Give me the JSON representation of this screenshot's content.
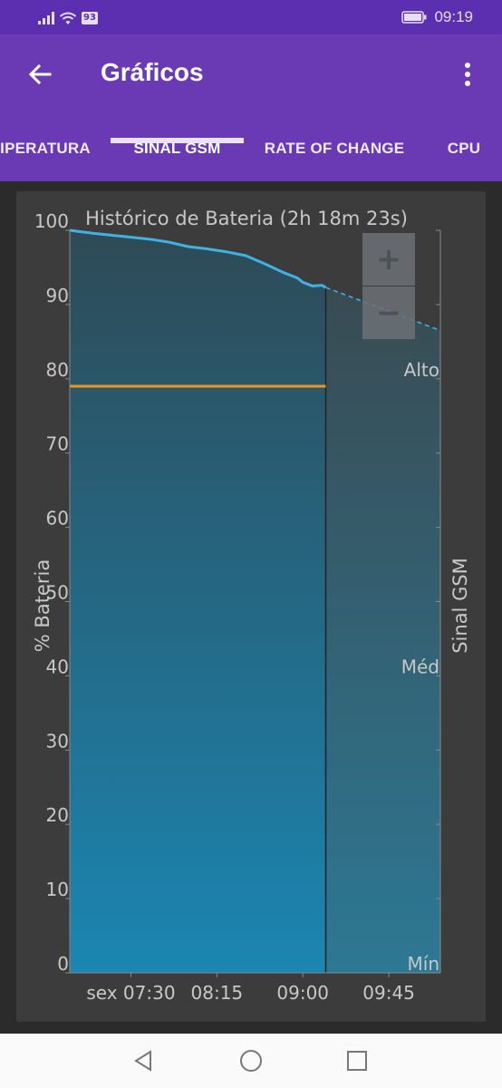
{
  "status_bar": {
    "battery_badge": "93",
    "time": "09:19"
  },
  "app_bar": {
    "title": "Gráficos"
  },
  "tabs": [
    {
      "label": "IPERATURA",
      "selected": false
    },
    {
      "label": "SINAL GSM",
      "selected": true
    },
    {
      "label": "RATE OF CHANGE",
      "selected": false
    },
    {
      "label": "CPU",
      "selected": false
    }
  ],
  "chart": {
    "zoom_in": "+",
    "zoom_out": "−"
  },
  "chart_data": {
    "type": "area",
    "title": "Histórico de Bateria (2h 18m 23s)",
    "ylabel": "% Bateria",
    "y2label": "Sinal GSM",
    "ylim": [
      0,
      100
    ],
    "yticks": [
      "0",
      "10",
      "20",
      "30",
      "40",
      "50",
      "60",
      "70",
      "80",
      "90",
      "100"
    ],
    "y2ticks": [
      "Mín",
      "Méd",
      "Alto"
    ],
    "xlim": [
      "06:58",
      "10:12"
    ],
    "xticks": [
      {
        "label": "sex 07:30",
        "time": "07:30"
      },
      {
        "label": "08:15",
        "time": "08:15"
      },
      {
        "label": "09:00",
        "time": "09:00"
      },
      {
        "label": "09:45",
        "time": "09:45"
      }
    ],
    "series": [
      {
        "kind": "battery",
        "color": "#3fb2e2",
        "x": [
          "06:58",
          "07:10",
          "07:25",
          "07:40",
          "07:50",
          "08:00",
          "08:10",
          "08:20",
          "08:30",
          "08:40",
          "08:50",
          "08:57",
          "09:00",
          "09:05",
          "09:10",
          "09:12"
        ],
        "values": [
          100,
          99.6,
          99.2,
          98.8,
          98.4,
          97.8,
          97.5,
          97.1,
          96.6,
          95.5,
          94.3,
          93.6,
          93.0,
          92.5,
          92.6,
          92.3
        ]
      },
      {
        "kind": "projection",
        "color": "#3fb2e2",
        "dashed": true,
        "x": [
          "09:12",
          "10:12"
        ],
        "values": [
          92.3,
          86.5
        ]
      },
      {
        "kind": "gsm_signal",
        "color": "#f0941e",
        "x": [
          "06:58",
          "09:12"
        ],
        "values": [
          79,
          79
        ]
      }
    ]
  }
}
